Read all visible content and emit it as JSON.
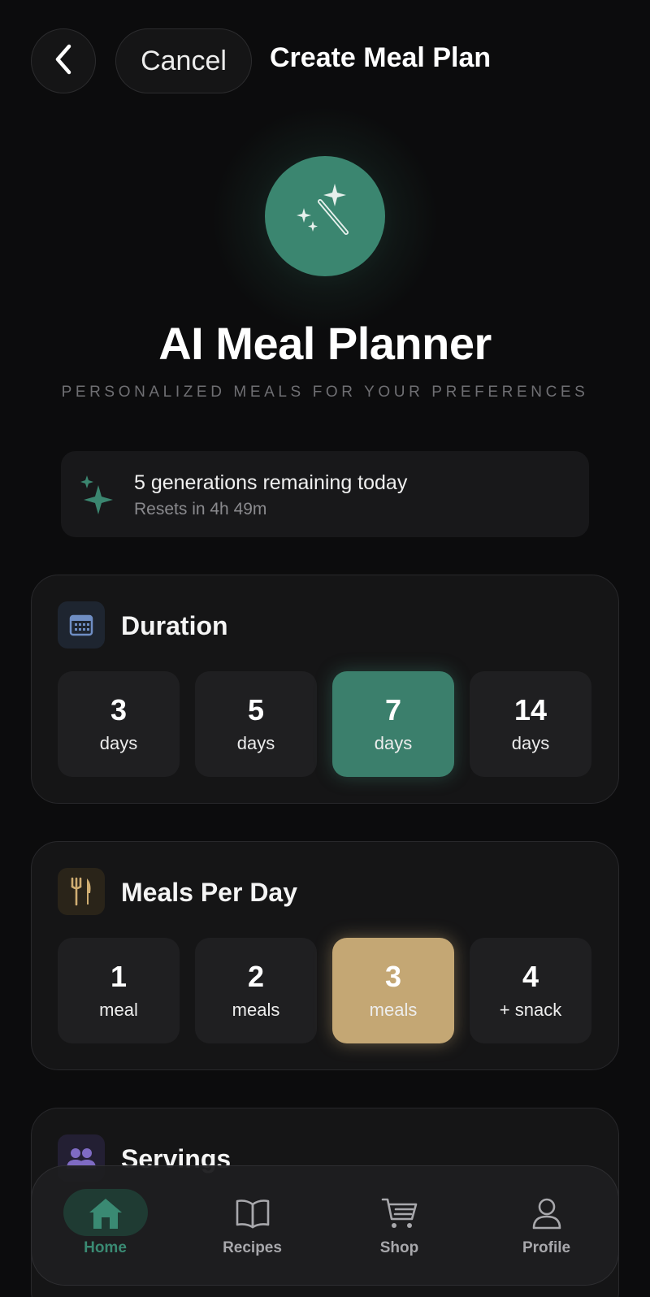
{
  "header": {
    "back_icon": "chevron-left-icon",
    "cancel_label": "Cancel",
    "title": "Create Meal Plan"
  },
  "hero": {
    "icon": "magic-wand-sparkles-icon",
    "title": "AI Meal Planner",
    "subtitle": "PERSONALIZED MEALS FOR YOUR PREFERENCES"
  },
  "generations": {
    "icon": "sparkles-icon",
    "main": "5 generations remaining today",
    "reset": "Resets in 4h 49m"
  },
  "duration": {
    "icon": "calendar-icon",
    "title": "Duration",
    "options": [
      {
        "value": "3",
        "unit": "days",
        "selected": false
      },
      {
        "value": "5",
        "unit": "days",
        "selected": false
      },
      {
        "value": "7",
        "unit": "days",
        "selected": true
      },
      {
        "value": "14",
        "unit": "days",
        "selected": false
      }
    ]
  },
  "meals": {
    "icon": "fork-knife-icon",
    "title": "Meals Per Day",
    "options": [
      {
        "value": "1",
        "unit": "meal",
        "selected": false
      },
      {
        "value": "2",
        "unit": "meals",
        "selected": false
      },
      {
        "value": "3",
        "unit": "meals",
        "selected": true
      },
      {
        "value": "4",
        "unit": "+ snack",
        "selected": false
      }
    ]
  },
  "servings": {
    "icon": "people-icon",
    "title": "Servings"
  },
  "nav": {
    "items": [
      {
        "label": "Home",
        "icon": "home-icon",
        "active": true
      },
      {
        "label": "Recipes",
        "icon": "book-icon",
        "active": false
      },
      {
        "label": "Shop",
        "icon": "cart-icon",
        "active": false
      },
      {
        "label": "Profile",
        "icon": "person-icon",
        "active": false
      }
    ]
  },
  "colors": {
    "background": "#0c0c0d",
    "accent_green": "#3b8670",
    "accent_gold": "#c4a774",
    "card": "#151516"
  }
}
